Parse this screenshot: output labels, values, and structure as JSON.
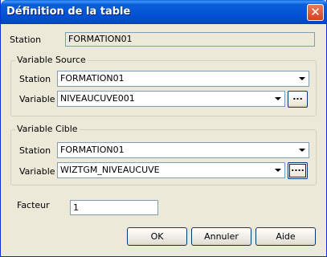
{
  "window": {
    "title": "Définition de la table",
    "close_glyph": "✕"
  },
  "station": {
    "label": "Station",
    "value": "FORMATION01"
  },
  "source": {
    "group_title": "Variable Source",
    "station_label": "Station",
    "station_value": "FORMATION01",
    "variable_label": "Variable",
    "variable_value": "NIVEAUCUVE001",
    "browse_label": "..."
  },
  "cible": {
    "group_title": "Variable Cible",
    "station_label": "Station",
    "station_value": "FORMATION01",
    "variable_label": "Variable",
    "variable_value": "WIZTGM_NIVEAUCUVE",
    "browse_label": "...."
  },
  "facteur": {
    "label": "Facteur",
    "value": "1"
  },
  "buttons": {
    "ok": "OK",
    "annuler": "Annuler",
    "aide": "Aide"
  },
  "icons": {
    "dropdown": "chevron-down-icon",
    "close": "close-icon"
  }
}
